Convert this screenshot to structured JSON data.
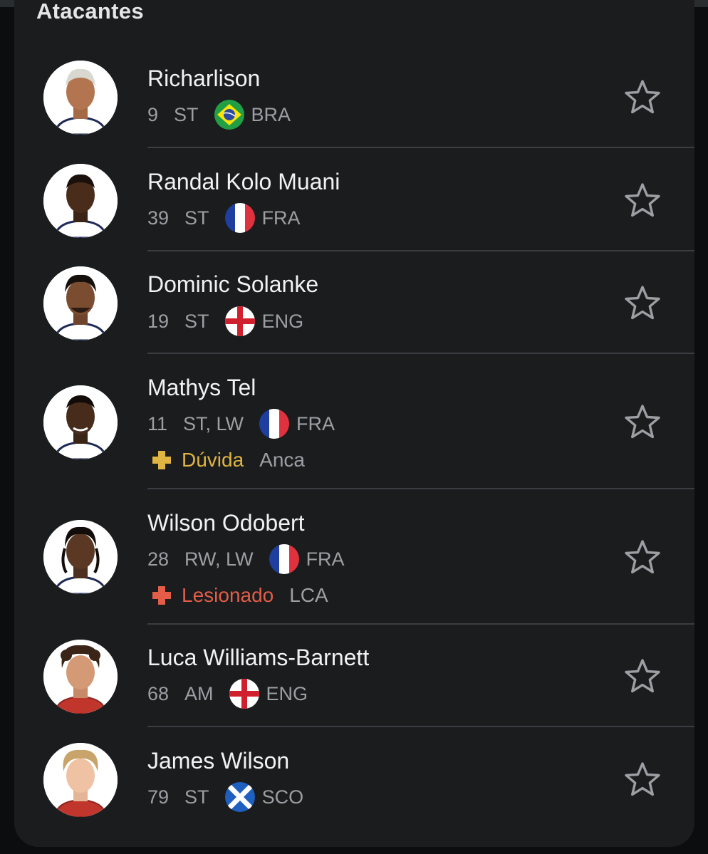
{
  "section": {
    "title": "Atacantes"
  },
  "players": [
    {
      "name": "Richarlison",
      "number": "9",
      "position": "ST",
      "country": "BRA",
      "flag": "brazil",
      "status": null
    },
    {
      "name": "Randal Kolo Muani",
      "number": "39",
      "position": "ST",
      "country": "FRA",
      "flag": "france",
      "status": null
    },
    {
      "name": "Dominic Solanke",
      "number": "19",
      "position": "ST",
      "country": "ENG",
      "flag": "england",
      "status": null
    },
    {
      "name": "Mathys Tel",
      "number": "11",
      "position": "ST, LW",
      "country": "FRA",
      "flag": "france",
      "status": {
        "label": "Dúvida",
        "note": "Anca",
        "color": "#e0b443"
      }
    },
    {
      "name": "Wilson Odobert",
      "number": "28",
      "position": "RW, LW",
      "country": "FRA",
      "flag": "france",
      "status": {
        "label": "Lesionado",
        "note": "LCA",
        "color": "#e35d48"
      }
    },
    {
      "name": "Luca Williams-Barnett",
      "number": "68",
      "position": "AM",
      "country": "ENG",
      "flag": "england",
      "status": null
    },
    {
      "name": "James Wilson",
      "number": "79",
      "position": "ST",
      "country": "SCO",
      "flag": "scotland",
      "status": null
    }
  ],
  "icons": {
    "favorite": "star-outline-icon",
    "status": "plus-cross-icon"
  },
  "colors": {
    "card": "#1a1c1e",
    "text": "#f2f2f2",
    "muted": "#9c9fa3",
    "divider": "#3a3d41"
  }
}
